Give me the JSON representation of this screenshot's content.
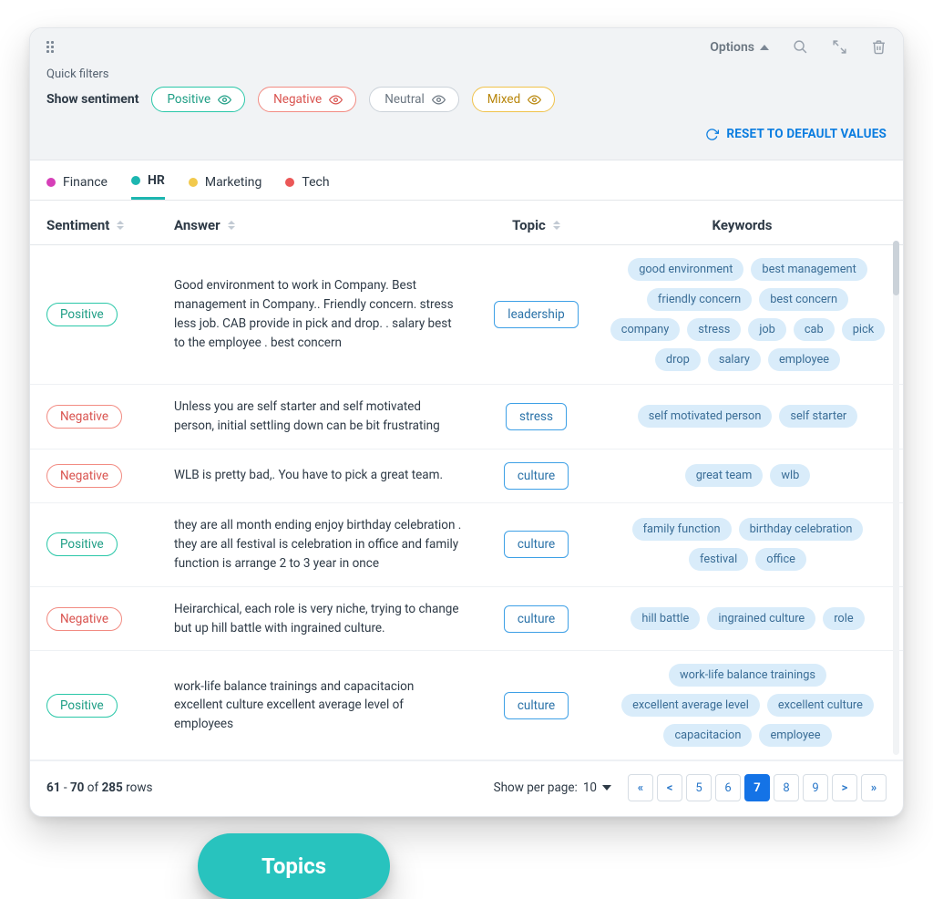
{
  "toolbar": {
    "options_label": "Options"
  },
  "filters": {
    "quick_label": "Quick filters",
    "show_sentiment_label": "Show sentiment",
    "chips": [
      "Positive",
      "Negative",
      "Neutral",
      "Mixed"
    ],
    "reset_label": "RESET TO DEFAULT VALUES"
  },
  "tabs": [
    {
      "label": "Finance",
      "color": "#d63fb8"
    },
    {
      "label": "HR",
      "color": "#1cb6b0",
      "active": true
    },
    {
      "label": "Marketing",
      "color": "#f2c94c"
    },
    {
      "label": "Tech",
      "color": "#eb5757"
    }
  ],
  "columns": {
    "sentiment": "Sentiment",
    "answer": "Answer",
    "topic": "Topic",
    "keywords": "Keywords"
  },
  "rows": [
    {
      "sentiment": "Positive",
      "answer": "Good environment to work in Company. Best management in Company.. Friendly concern. stress less job. CAB provide in pick and drop. . salary best to the employee . best concern",
      "topic": "leadership",
      "keywords": [
        "good environment",
        "best management",
        "friendly concern",
        "best concern",
        "company",
        "stress",
        "job",
        "cab",
        "pick",
        "drop",
        "salary",
        "employee"
      ]
    },
    {
      "sentiment": "Negative",
      "answer": "Unless you are self starter and self motivated person, initial settling down can be bit frustrating",
      "topic": "stress",
      "keywords": [
        "self motivated person",
        "self starter"
      ]
    },
    {
      "sentiment": "Negative",
      "answer": "WLB is pretty bad,. You have to pick a great team.",
      "topic": "culture",
      "keywords": [
        "great team",
        "wlb"
      ]
    },
    {
      "sentiment": "Positive",
      "answer": "they are all month ending enjoy birthday celebration . they are all festival is celebration in office and family function is arrange 2 to 3 year in once",
      "topic": "culture",
      "keywords": [
        "family function",
        "birthday celebration",
        "festival",
        "office"
      ]
    },
    {
      "sentiment": "Negative",
      "answer": "Heirarchical, each role is very niche, trying to change but up hill battle with ingrained culture.",
      "topic": "culture",
      "keywords": [
        "hill battle",
        "ingrained culture",
        "role"
      ]
    },
    {
      "sentiment": "Positive",
      "answer": "work-life balance trainings and capacitacion excellent culture excellent average level of employees",
      "topic": "culture",
      "keywords": [
        "work-life balance trainings",
        "excellent average level",
        "excellent culture",
        "capacitacion",
        "employee"
      ]
    }
  ],
  "pagination": {
    "range_from": "61",
    "range_to": "70",
    "total": "285",
    "rows_label": "rows",
    "of_label": "of",
    "per_page_label": "Show per page:",
    "per_page_value": "10",
    "pages": [
      "«",
      "<",
      "5",
      "6",
      "7",
      "8",
      "9",
      ">",
      "»"
    ],
    "active_page": "7"
  },
  "badge": {
    "label": "Topics"
  }
}
